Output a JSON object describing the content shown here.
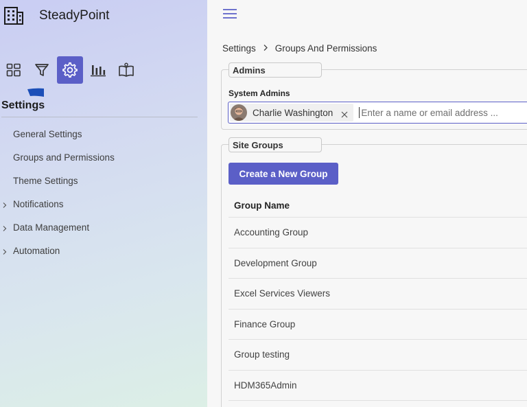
{
  "app": {
    "name": "SteadyPoint",
    "brand_icon": "building-icon"
  },
  "sidebar": {
    "icon_bar": [
      {
        "icon": "dashboard-grid-icon",
        "active": false
      },
      {
        "icon": "filter-icon",
        "active": false
      },
      {
        "icon": "gear-icon",
        "active": true
      },
      {
        "icon": "bar-chart-icon",
        "active": false
      },
      {
        "icon": "book-icon",
        "active": false
      }
    ],
    "heading": "Settings",
    "items": [
      {
        "label": "General Settings",
        "expandable": false
      },
      {
        "label": "Groups and Permissions",
        "expandable": false
      },
      {
        "label": "Theme Settings",
        "expandable": false
      },
      {
        "label": "Notifications",
        "expandable": true
      },
      {
        "label": "Data Management",
        "expandable": true
      },
      {
        "label": "Automation",
        "expandable": true
      }
    ]
  },
  "breadcrumb": {
    "root": "Settings",
    "current": "Groups And Permissions"
  },
  "admins": {
    "legend": "Admins",
    "field_label": "System Admins",
    "selected_person": "Charlie Washington",
    "placeholder": "Enter a name or email address ..."
  },
  "site_groups": {
    "legend": "Site Groups",
    "create_button": "Create a New Group",
    "column_header": "Group Name",
    "rows": [
      "Accounting Group",
      "Development Group",
      "Excel Services Viewers",
      "Finance Group",
      "Group testing",
      "HDM365Admin"
    ]
  },
  "colors": {
    "accent": "#5b5fc7",
    "sidebar_top": "#c9cdf3",
    "sidebar_bottom": "#dcefe6"
  }
}
